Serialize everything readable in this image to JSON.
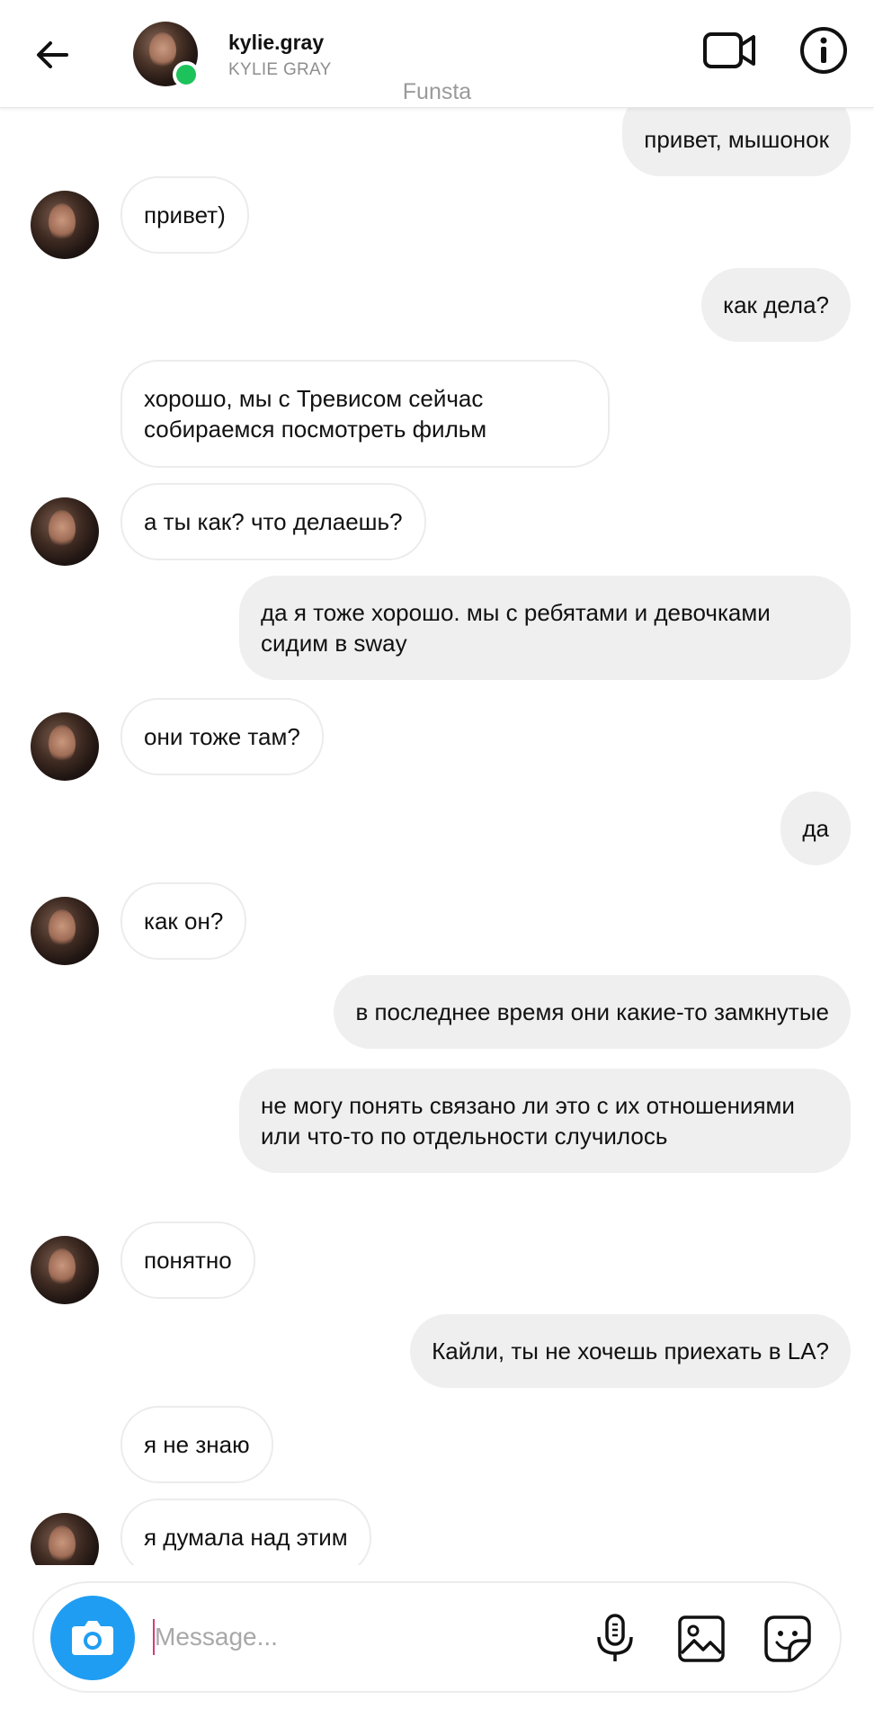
{
  "header": {
    "username": "kylie.gray",
    "full_name": "KYLIE GRAY",
    "account_label": "Funsta",
    "online": true,
    "icons": [
      "back-arrow-icon",
      "video-call-icon",
      "info-icon"
    ]
  },
  "messages": [
    {
      "dir": "out",
      "text": "привет, мышонок"
    },
    {
      "dir": "in",
      "text": "привет)",
      "avatar": true
    },
    {
      "dir": "out",
      "text": "как дела?"
    },
    {
      "dir": "in",
      "text": "хорошо, мы с Тревисом сейчас собираемся посмотреть фильм",
      "avatar": false
    },
    {
      "dir": "in",
      "text": "а ты как? что делаешь?",
      "avatar": true
    },
    {
      "dir": "out",
      "text": "да я тоже хорошо. мы с ребятами и девочками сидим в sway"
    },
    {
      "dir": "in",
      "text": "они тоже там?",
      "avatar": true
    },
    {
      "dir": "out",
      "text": "да"
    },
    {
      "dir": "in",
      "text": "как он?",
      "avatar": true
    },
    {
      "dir": "out",
      "text": "в последнее время они какие-то замкнутые"
    },
    {
      "dir": "out",
      "text": "не могу понять связано ли это с их отношениями или что-то по отдельности случилось"
    },
    {
      "dir": "in",
      "text": "понятно",
      "avatar": true
    },
    {
      "dir": "out",
      "text": "Кайли, ты не хочешь приехать в LA?"
    },
    {
      "dir": "in",
      "text": "я не знаю",
      "avatar": false
    },
    {
      "dir": "in",
      "text": "я думала над этим",
      "avatar": true
    }
  ],
  "composer": {
    "placeholder": "Message...",
    "value": "",
    "icons": [
      "camera-icon",
      "microphone-icon",
      "gallery-icon",
      "sticker-icon"
    ]
  },
  "colors": {
    "online": "#1ec25b",
    "camera_button": "#1f9df2",
    "outgoing_bubble": "#efefef",
    "incoming_border": "#ececec",
    "caret": "#d63b78"
  }
}
